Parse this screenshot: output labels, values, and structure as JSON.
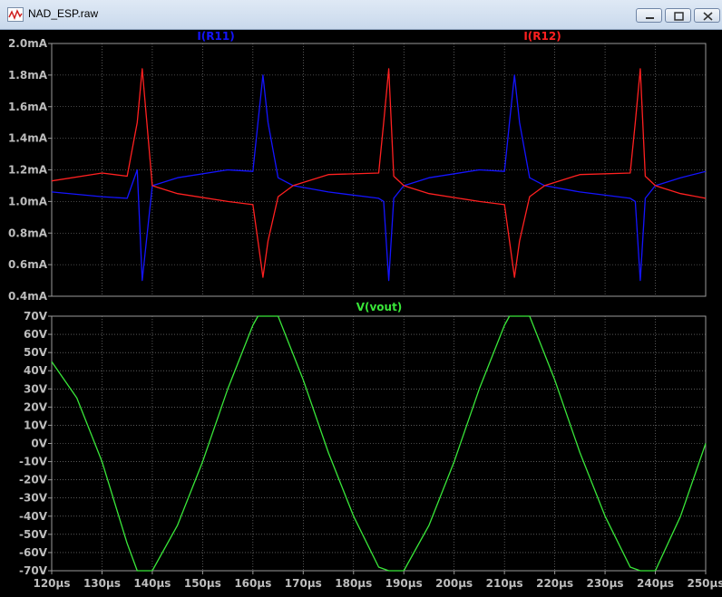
{
  "window": {
    "title": "NAD_ESP.raw"
  },
  "colors": {
    "trace1": "#1414ff",
    "trace2": "#ff2020",
    "trace3": "#39e639",
    "grid": "#8c8c8c",
    "frame": "#9a9a9a",
    "tick_text": "#bdbdbd"
  },
  "top_pane": {
    "traces": [
      {
        "name": "I(R11)",
        "color": "#1414ff"
      },
      {
        "name": "I(R12)",
        "color": "#ff2020"
      }
    ],
    "y_ticks": [
      "2.0mA",
      "1.8mA",
      "1.6mA",
      "1.4mA",
      "1.2mA",
      "1.0mA",
      "0.8mA",
      "0.6mA",
      "0.4mA"
    ]
  },
  "bottom_pane": {
    "traces": [
      {
        "name": "V(vout)",
        "color": "#39e639"
      }
    ],
    "y_ticks": [
      "70V",
      "60V",
      "50V",
      "40V",
      "30V",
      "20V",
      "10V",
      "0V",
      "-10V",
      "-20V",
      "-30V",
      "-40V",
      "-50V",
      "-60V",
      "-70V"
    ]
  },
  "x_ticks": [
    "120µs",
    "130µs",
    "140µs",
    "150µs",
    "160µs",
    "170µs",
    "180µs",
    "190µs",
    "200µs",
    "210µs",
    "220µs",
    "230µs",
    "240µs",
    "250µs"
  ],
  "chart_data": [
    {
      "type": "line",
      "x_unit": "µs",
      "xlim": [
        120,
        250
      ],
      "ylim_mA": [
        0.4,
        2.0
      ],
      "series": [
        {
          "name": "I(R11)",
          "x": [
            120,
            130,
            135,
            137,
            138,
            140,
            141,
            145,
            155,
            160,
            161,
            162,
            163,
            165,
            168,
            175,
            185,
            186,
            187,
            188,
            190,
            191,
            195,
            205,
            210,
            211,
            212,
            213,
            215,
            218,
            225,
            235,
            236,
            237,
            238,
            240,
            241,
            245,
            250
          ],
          "y": [
            1.06,
            1.03,
            1.02,
            1.2,
            0.5,
            1.1,
            1.11,
            1.15,
            1.2,
            1.19,
            1.5,
            1.8,
            1.5,
            1.15,
            1.1,
            1.06,
            1.02,
            1.0,
            0.5,
            1.02,
            1.1,
            1.11,
            1.15,
            1.2,
            1.19,
            1.5,
            1.8,
            1.5,
            1.15,
            1.1,
            1.06,
            1.02,
            1.0,
            0.5,
            1.02,
            1.1,
            1.11,
            1.15,
            1.19
          ]
        },
        {
          "name": "I(R12)",
          "x": [
            120,
            130,
            135,
            137,
            138,
            140,
            141,
            145,
            155,
            160,
            161,
            162,
            163,
            165,
            168,
            175,
            185,
            186,
            187,
            188,
            190,
            191,
            195,
            205,
            210,
            211,
            212,
            213,
            215,
            218,
            225,
            235,
            236,
            237,
            238,
            240,
            241,
            245,
            250
          ],
          "y": [
            1.13,
            1.18,
            1.16,
            1.5,
            1.84,
            1.1,
            1.09,
            1.05,
            1.0,
            0.98,
            0.75,
            0.52,
            0.75,
            1.03,
            1.1,
            1.17,
            1.18,
            1.5,
            1.84,
            1.16,
            1.1,
            1.09,
            1.05,
            1.0,
            0.98,
            0.75,
            0.52,
            0.75,
            1.03,
            1.1,
            1.17,
            1.18,
            1.5,
            1.84,
            1.16,
            1.1,
            1.09,
            1.05,
            1.02
          ]
        }
      ]
    },
    {
      "type": "line",
      "x_unit": "µs",
      "xlim": [
        120,
        250
      ],
      "ylim_V": [
        -70,
        70
      ],
      "series": [
        {
          "name": "V(vout)",
          "x": [
            120,
            125,
            130,
            135,
            137,
            140,
            145,
            150,
            155,
            160,
            161,
            165,
            170,
            175,
            180,
            185,
            187,
            190,
            195,
            200,
            205,
            210,
            211,
            215,
            220,
            225,
            230,
            235,
            237,
            240,
            245,
            250
          ],
          "y": [
            45,
            25,
            -10,
            -55,
            -70,
            -70,
            -45,
            -10,
            30,
            65,
            70,
            70,
            35,
            -5,
            -40,
            -68,
            -70,
            -70,
            -45,
            -10,
            30,
            65,
            70,
            70,
            35,
            -5,
            -40,
            -68,
            -70,
            -70,
            -40,
            0
          ]
        }
      ]
    }
  ]
}
